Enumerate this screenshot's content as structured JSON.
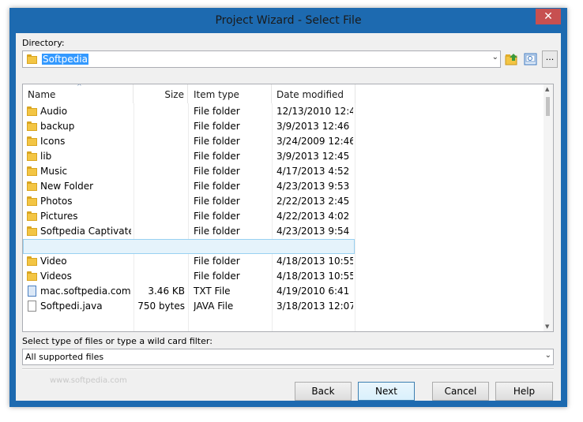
{
  "window": {
    "title": "Project Wizard - Select File",
    "close_glyph": "✕"
  },
  "directory": {
    "label": "Directory:",
    "value": "Softpedia",
    "more_label": "..."
  },
  "columns": {
    "name": "Name",
    "size": "Size",
    "type": "Item type",
    "date": "Date modified"
  },
  "files": [
    {
      "name": "Audio",
      "size": "",
      "type": "File folder",
      "date": "12/13/2010 12:4...",
      "icon": "folder-icon"
    },
    {
      "name": "backup",
      "size": "",
      "type": "File folder",
      "date": "3/9/2013 12:46 ...",
      "icon": "folder-icon"
    },
    {
      "name": "Icons",
      "size": "",
      "type": "File folder",
      "date": "3/24/2009 12:46...",
      "icon": "folder-icon"
    },
    {
      "name": "lib",
      "size": "",
      "type": "File folder",
      "date": "3/9/2013 12:45 ...",
      "icon": "folder-icon"
    },
    {
      "name": "Music",
      "size": "",
      "type": "File folder",
      "date": "4/17/2013 4:52 ...",
      "icon": "folder-icon"
    },
    {
      "name": "New Folder",
      "size": "",
      "type": "File folder",
      "date": "4/23/2013 9:53 ...",
      "icon": "folder-icon"
    },
    {
      "name": "Photos",
      "size": "",
      "type": "File folder",
      "date": "2/22/2013 2:45 ...",
      "icon": "folder-icon"
    },
    {
      "name": "Pictures",
      "size": "",
      "type": "File folder",
      "date": "4/22/2013 4:02 ...",
      "icon": "folder-icon"
    },
    {
      "name": "Softpedia Captivate",
      "size": "",
      "type": "File folder",
      "date": "4/23/2013 9:54 ...",
      "icon": "folder-icon"
    },
    {
      "name": "",
      "size": "",
      "type": "",
      "date": "",
      "icon": ""
    },
    {
      "name": "Video",
      "size": "",
      "type": "File folder",
      "date": "4/18/2013 10:55...",
      "icon": "folder-icon"
    },
    {
      "name": "Videos",
      "size": "",
      "type": "File folder",
      "date": "4/18/2013 10:55...",
      "icon": "folder-icon"
    },
    {
      "name": "mac.softpedia.com....",
      "size": "3.46 KB",
      "type": "TXT File",
      "date": "4/19/2010 6:41 ...",
      "icon": "text-file-icon"
    },
    {
      "name": "Softpedi.java",
      "size": "750 bytes",
      "type": "JAVA File",
      "date": "3/18/2013 12:07...",
      "icon": "file-icon"
    }
  ],
  "filter": {
    "label": "Select type of files or type a wild card filter:",
    "value": "All supported files"
  },
  "watermark": "www.softpedia.com",
  "buttons": {
    "back": "Back",
    "next": "Next",
    "cancel": "Cancel",
    "help": "Help"
  },
  "colors": {
    "titlebar": "#1d6ab0",
    "close": "#c75050",
    "selection": "#3399ff",
    "folder": "#f3c544"
  }
}
